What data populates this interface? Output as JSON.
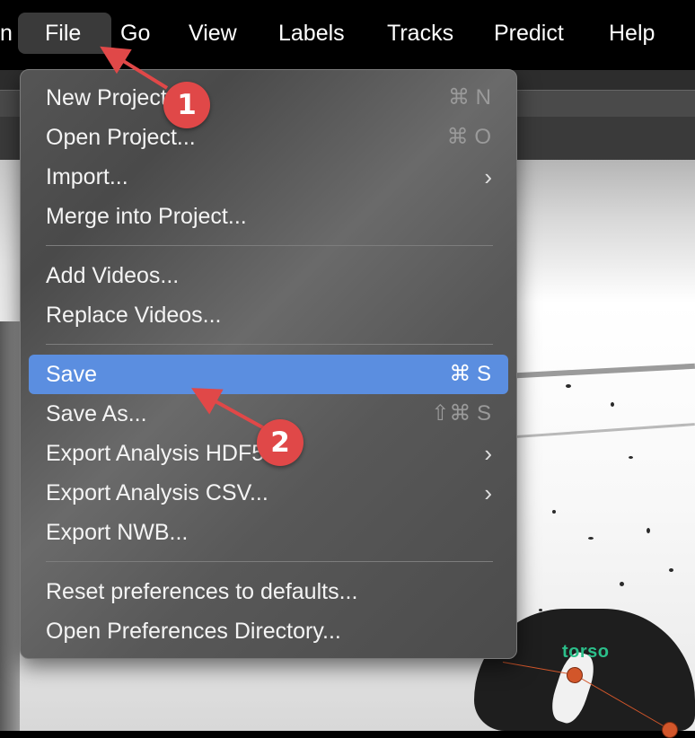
{
  "menubar": {
    "items": [
      {
        "label": "n"
      },
      {
        "label": "File"
      },
      {
        "label": "Go"
      },
      {
        "label": "View"
      },
      {
        "label": "Labels"
      },
      {
        "label": "Tracks"
      },
      {
        "label": "Predict"
      },
      {
        "label": "Help"
      }
    ],
    "active": "File"
  },
  "file_menu": {
    "items": [
      {
        "label": "New Project...",
        "shortcut": "⌘ N"
      },
      {
        "label": "Open Project...",
        "shortcut": "⌘ O"
      },
      {
        "label": "Import...",
        "submenu": "›"
      },
      {
        "label": "Merge into Project..."
      },
      {
        "label": "Add Videos..."
      },
      {
        "label": "Replace Videos..."
      },
      {
        "label": "Save",
        "shortcut": "⌘ S",
        "highlighted": true
      },
      {
        "label": "Save As...",
        "shortcut": "⇧⌘ S"
      },
      {
        "label": "Export Analysis HDF5...",
        "submenu": "›"
      },
      {
        "label": "Export Analysis CSV...",
        "submenu": "›"
      },
      {
        "label": "Export NWB..."
      },
      {
        "label": "Reset preferences to defaults..."
      },
      {
        "label": "Open Preferences Directory..."
      }
    ]
  },
  "annotations": [
    {
      "number": "1"
    },
    {
      "number": "2"
    }
  ],
  "video": {
    "node_label": "torso"
  },
  "colors": {
    "highlight": "#5b8ee0",
    "badge": "#e04848",
    "node": "#d2562a",
    "node_label": "#2bbf8a"
  }
}
